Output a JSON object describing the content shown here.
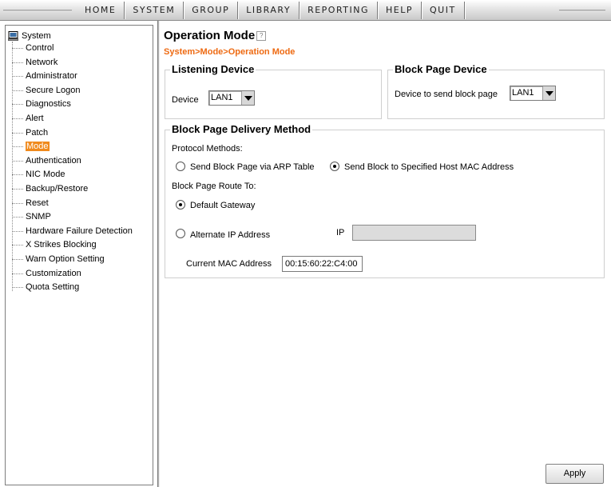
{
  "menu": [
    "HOME",
    "SYSTEM",
    "GROUP",
    "LIBRARY",
    "REPORTING",
    "HELP",
    "QUIT"
  ],
  "sidebar": {
    "root_label": "System",
    "items": [
      {
        "label": "Control",
        "selected": false
      },
      {
        "label": "Network",
        "selected": false
      },
      {
        "label": "Administrator",
        "selected": false
      },
      {
        "label": "Secure Logon",
        "selected": false
      },
      {
        "label": "Diagnostics",
        "selected": false
      },
      {
        "label": "Alert",
        "selected": false
      },
      {
        "label": "Patch",
        "selected": false
      },
      {
        "label": "Mode",
        "selected": true
      },
      {
        "label": "Authentication",
        "selected": false
      },
      {
        "label": "NIC Mode",
        "selected": false
      },
      {
        "label": "Backup/Restore",
        "selected": false
      },
      {
        "label": "Reset",
        "selected": false
      },
      {
        "label": "SNMP",
        "selected": false
      },
      {
        "label": "Hardware Failure Detection",
        "selected": false
      },
      {
        "label": "X Strikes Blocking",
        "selected": false
      },
      {
        "label": "Warn Option Setting",
        "selected": false
      },
      {
        "label": "Customization",
        "selected": false
      },
      {
        "label": "Quota Setting",
        "selected": false
      }
    ],
    "selected_color": "#f08a1c"
  },
  "page": {
    "title": "Operation Mode",
    "breadcrumb": "System>Mode>Operation Mode",
    "breadcrumb_color": "#ee6a12"
  },
  "listening_device": {
    "legend": "Listening Device",
    "device_label": "Device",
    "device_value": "LAN1"
  },
  "block_page_device": {
    "legend": "Block Page Device",
    "label": "Device to send block page",
    "value": "LAN1"
  },
  "delivery": {
    "legend": "Block Page Delivery Method",
    "protocol_label": "Protocol Methods:",
    "protocol_options": [
      {
        "label": "Send Block Page via ARP Table",
        "checked": false
      },
      {
        "label": "Send Block to Specified Host MAC Address",
        "checked": true
      }
    ],
    "route_label": "Block Page Route To:",
    "route_options": [
      {
        "label": "Default Gateway",
        "checked": true
      },
      {
        "label": "Alternate IP Address",
        "checked": false
      }
    ],
    "ip_label": "IP",
    "ip_value": "",
    "mac_label": "Current MAC Address",
    "mac_value": "00:15:60:22:C4:00"
  },
  "apply_label": "Apply"
}
